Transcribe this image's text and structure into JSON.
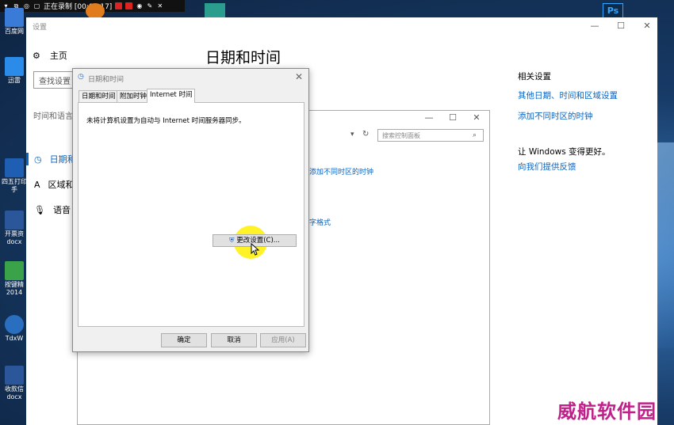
{
  "recorder": {
    "status": "正在录制 [00:00:17]"
  },
  "desktop_icons": [
    {
      "label": "百度网"
    },
    {
      "label": "迅雷"
    },
    {
      "label": "四五打印手"
    },
    {
      "label": "开票资docx"
    },
    {
      "label": "按键精2014"
    },
    {
      "label": "TdxW"
    },
    {
      "label": "收款信docx"
    }
  ],
  "settings": {
    "window_title": "设置",
    "home": "主页",
    "search_placeholder": "查找设置",
    "section": "时间和语言",
    "nav": [
      "日期和",
      "区域和",
      "语音"
    ],
    "page_title": "日期和时间",
    "related_title": "相关设置",
    "related_links": [
      "其他日期、时间和区域设置",
      "添加不同时区的时钟"
    ],
    "feedback_title": "让 Windows 变得更好。",
    "feedback_link": "向我们提供反馈"
  },
  "control_panel": {
    "search_placeholder": "搜索控制面板",
    "links": [
      "添加不同时区的时钟",
      "字格式"
    ]
  },
  "dialog": {
    "title": "日期和时间",
    "tabs": [
      "日期和时间",
      "附加时钟",
      "Internet 时间"
    ],
    "active_tab": 2,
    "message": "未将计算机设置为自动与 Internet 时间服务器同步。",
    "change_button": "更改设置(C)...",
    "ok": "确定",
    "cancel": "取消",
    "apply": "应用(A)"
  },
  "watermark": "威航软件园"
}
